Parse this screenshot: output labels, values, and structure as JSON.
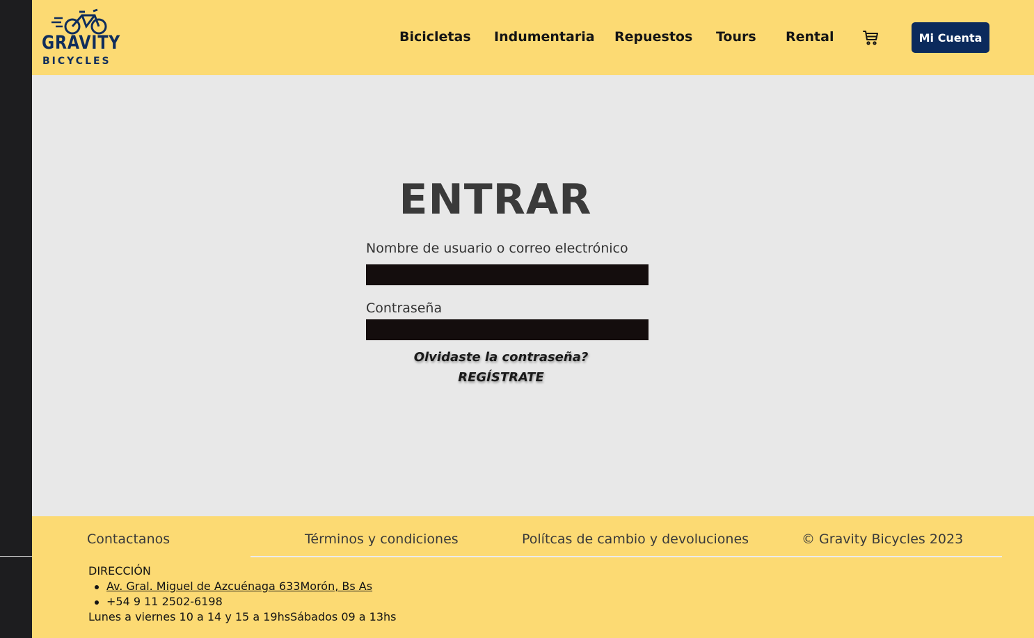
{
  "brand": {
    "name_line1": "GRAVITY",
    "name_line2": "BICYCLES",
    "logo_color": "#0f2d5c"
  },
  "nav": {
    "items": [
      {
        "label": "Bicicletas"
      },
      {
        "label": "Indumentaria"
      },
      {
        "label": "Repuestos"
      },
      {
        "label": "Tours"
      },
      {
        "label": "Rental"
      }
    ],
    "cart_icon": "shopping-cart-icon",
    "account_label": "Mi Cuenta"
  },
  "login": {
    "title": "ENTRAR",
    "username_label": "Nombre de usuario o correo electrónico",
    "username_value": "",
    "password_label": "Contraseña",
    "password_value": "",
    "forgot_label": "Olvidaste la contraseña?",
    "register_label": "REGÍSTRATE"
  },
  "footer": {
    "links": [
      {
        "label": "Contactanos"
      },
      {
        "label": "Términos y condiciones"
      },
      {
        "label": "Polítcas de cambio y devoluciones"
      }
    ],
    "copyright": "© Gravity Bicycles 2023",
    "address_heading": "DIRECCIÓN",
    "address": "Av. Gral. Miguel de Azcuénaga 633Morón, Bs As",
    "phone": "+54 9 11 2502-6198",
    "hours": "Lunes a viernes 10 a 14 y 15 a 19hsSábados 09 a 13hs"
  },
  "colors": {
    "header_bg": "#fcda73",
    "page_bg": "#e8e8e8",
    "sidebar_bg": "#1d1d1f",
    "account_button": "#0b2a5c",
    "input_bg": "#140d0d"
  }
}
